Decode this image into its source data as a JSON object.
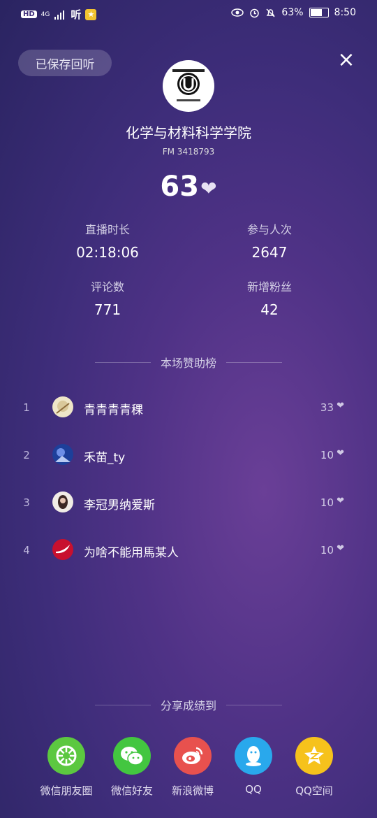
{
  "status_bar": {
    "hd": "HD",
    "network": "4G",
    "app_text": "听",
    "battery": "63%",
    "battery_level": 0.63,
    "time": "8:50"
  },
  "header": {
    "saved_label": "已保存回听",
    "close_glyph": "×"
  },
  "channel": {
    "name": "化学与材料科学学院",
    "fm_id": "FM 3418793",
    "likes": "63",
    "heart_glyph": "❤"
  },
  "stats": [
    {
      "label": "直播时长",
      "value": "02:18:06"
    },
    {
      "label": "参与人次",
      "value": "2647"
    },
    {
      "label": "评论数",
      "value": "771"
    },
    {
      "label": "新增粉丝",
      "value": "42"
    }
  ],
  "ranking": {
    "title": "本场赞助榜",
    "rows": [
      {
        "rank": "1",
        "name": "青青青青稞",
        "score": "33",
        "heart": "❤"
      },
      {
        "rank": "2",
        "name": "禾苗_ty",
        "score": "10",
        "heart": "❤"
      },
      {
        "rank": "3",
        "name": "李冠男纳爱斯",
        "score": "10",
        "heart": "❤"
      },
      {
        "rank": "4",
        "name": "为啥不能用馬某人",
        "score": "10",
        "heart": "❤"
      }
    ]
  },
  "share": {
    "title": "分享成绩到",
    "items": [
      {
        "label": "微信朋友圈",
        "icon": "wechat-moments-icon",
        "color": "#5cc840"
      },
      {
        "label": "微信好友",
        "icon": "wechat-icon",
        "color": "#43c640"
      },
      {
        "label": "新浪微博",
        "icon": "weibo-icon",
        "color": "#e8514e"
      },
      {
        "label": "QQ",
        "icon": "qq-icon",
        "color": "#29a8ec"
      },
      {
        "label": "QQ空间",
        "icon": "qzone-icon",
        "color": "#f6c21c"
      }
    ]
  }
}
